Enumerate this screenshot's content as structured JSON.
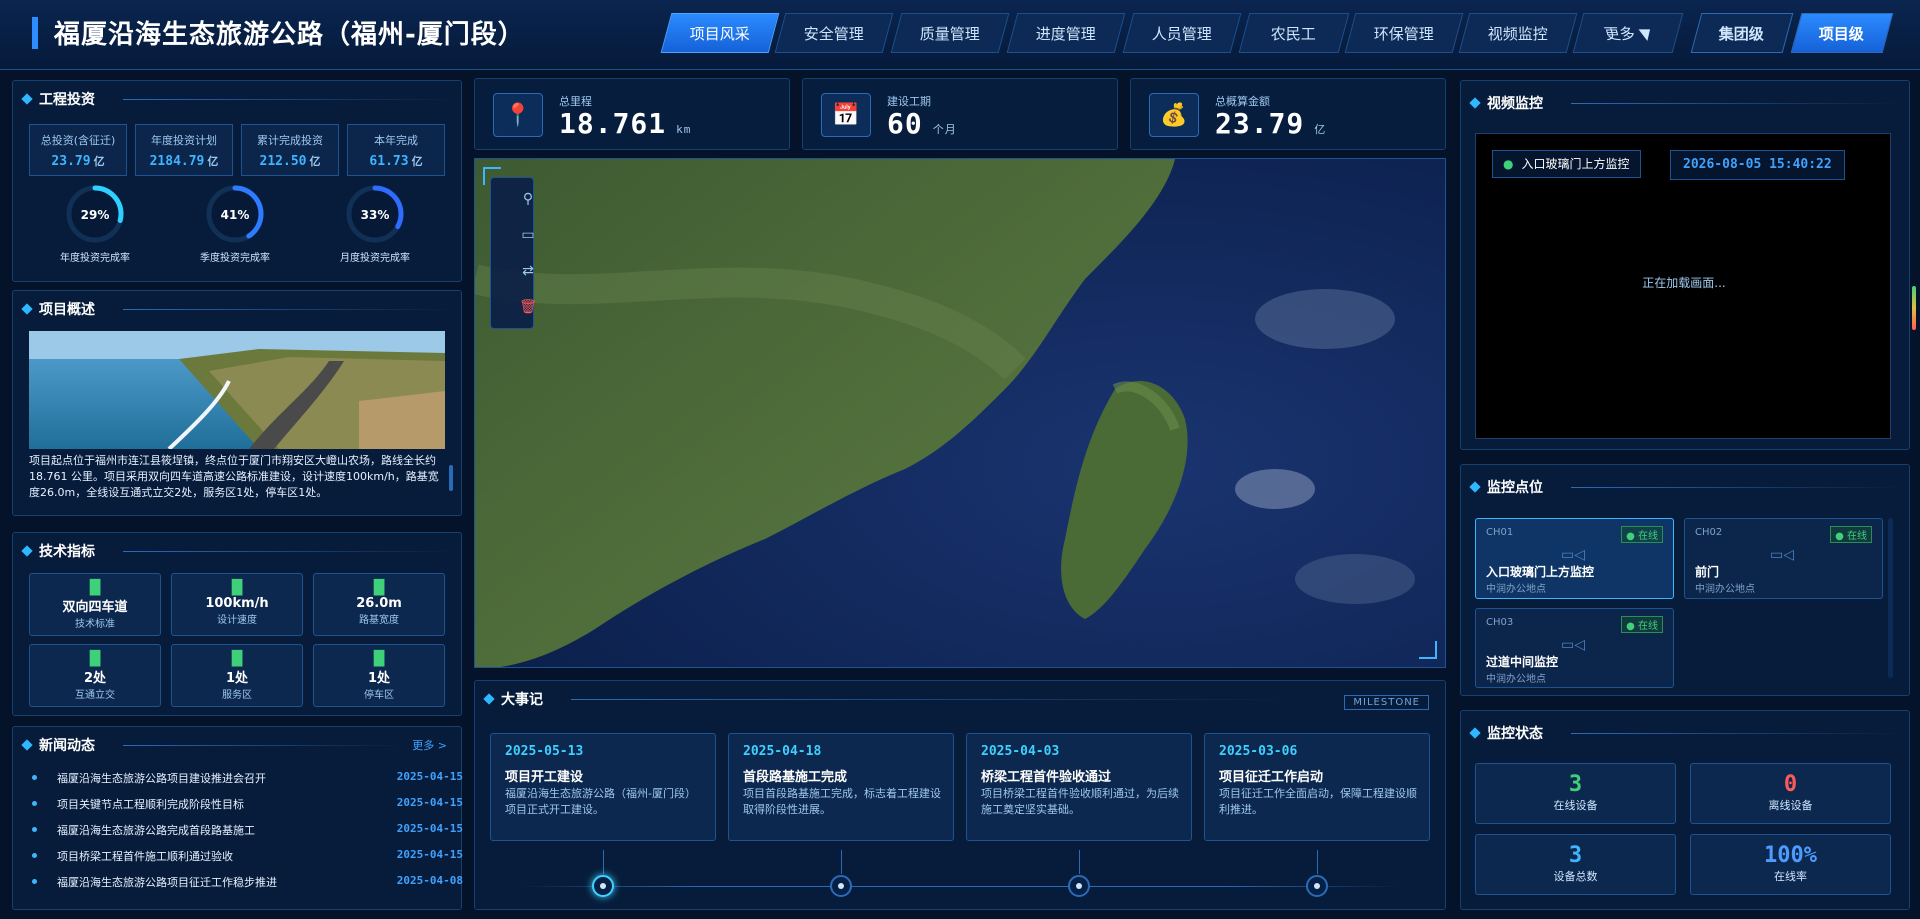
{
  "header": {
    "title": "福厦沿海生态旅游公路（福州-厦门段）",
    "tabs": [
      "项目风采",
      "安全管理",
      "质量管理",
      "进度管理",
      "人员管理",
      "农民工",
      "环保管理",
      "视频监控"
    ],
    "more_label": "更多",
    "level_tabs": [
      "集团级",
      "项目级"
    ],
    "active_tab": 0,
    "active_level": 1
  },
  "investment": {
    "title": "工程投资",
    "boxes": [
      {
        "label": "总投资(含征迁)",
        "value": "23.79",
        "unit": "亿"
      },
      {
        "label": "年度投资计划",
        "value": "2184.79",
        "unit": "亿"
      },
      {
        "label": "累计完成投资",
        "value": "212.50",
        "unit": "亿"
      },
      {
        "label": "本年完成",
        "value": "61.73",
        "unit": "亿"
      }
    ],
    "rings": [
      {
        "pct": 29,
        "text": "29%",
        "label": "年度投资完成率",
        "color": "#2ed0ff"
      },
      {
        "pct": 41,
        "text": "41%",
        "label": "季度投资完成率",
        "color": "#2e7bff"
      },
      {
        "pct": 33,
        "text": "33%",
        "label": "月度投资完成率",
        "color": "#2e6bff"
      }
    ]
  },
  "overview": {
    "title": "项目概述",
    "text": "项目起点位于福州市连江县筱埕镇，终点位于厦门市翔安区大嶝山农场，路线全长约 18.761 公里。项目采用双向四车道高速公路标准建设，设计速度100km/h，路基宽度26.0m，全线设互通式立交2处，服务区1处，停车区1处。"
  },
  "tech": {
    "title": "技术指标",
    "items": [
      {
        "value": "双向四车道",
        "label": "技术标准"
      },
      {
        "value": "100km/h",
        "label": "设计速度"
      },
      {
        "value": "26.0m",
        "label": "路基宽度"
      },
      {
        "value": "2处",
        "label": "互通立交"
      },
      {
        "value": "1处",
        "label": "服务区"
      },
      {
        "value": "1处",
        "label": "停车区"
      }
    ]
  },
  "news": {
    "title": "新闻动态",
    "more": "更多 >",
    "items": [
      {
        "title": "福厦沿海生态旅游公路项目建设推进会召开",
        "date": "2025-04-15"
      },
      {
        "title": "项目关键节点工程顺利完成阶段性目标",
        "date": "2025-04-15"
      },
      {
        "title": "福厦沿海生态旅游公路完成首段路基施工",
        "date": "2025-04-15"
      },
      {
        "title": "项目桥梁工程首件施工顺利通过验收",
        "date": "2025-04-15"
      },
      {
        "title": "福厦沿海生态旅游公路项目征迁工作稳步推进",
        "date": "2025-04-08"
      }
    ]
  },
  "stats": [
    {
      "label": "总里程",
      "value": "18.761",
      "unit": "km",
      "icon": "📍"
    },
    {
      "label": "建设工期",
      "value": "60",
      "unit": "个月",
      "icon": "📅"
    },
    {
      "label": "总概算金额",
      "value": "23.79",
      "unit": "亿",
      "icon": "💰"
    }
  ],
  "milestones": {
    "title": "大事记",
    "badge": "MILESTONE",
    "items": [
      {
        "date": "2025-05-13",
        "title": "项目开工建设",
        "desc": "福厦沿海生态旅游公路（福州-厦门段）项目正式开工建设。"
      },
      {
        "date": "2025-04-18",
        "title": "首段路基施工完成",
        "desc": "项目首段路基施工完成，标志着工程建设取得阶段性进展。"
      },
      {
        "date": "2025-04-03",
        "title": "桥梁工程首件验收通过",
        "desc": "项目桥梁工程首件验收顺利通过，为后续施工奠定坚实基础。"
      },
      {
        "date": "2025-03-06",
        "title": "项目征迁工作启动",
        "desc": "项目征迁工作全面启动，保障工程建设顺利推进。"
      }
    ]
  },
  "video": {
    "title": "视频监控",
    "camera_name": "入口玻璃门上方监控",
    "timestamp": "2026-08-05 15:40:22",
    "loading": "正在加载画面..."
  },
  "points": {
    "title": "监控点位",
    "items": [
      {
        "ch": "CH01",
        "status": "在线",
        "name": "入口玻璃门上方监控",
        "loc": "中润办公地点"
      },
      {
        "ch": "CH02",
        "status": "在线",
        "name": "前门",
        "loc": "中润办公地点"
      },
      {
        "ch": "CH03",
        "status": "在线",
        "name": "过道中间监控",
        "loc": "中润办公地点"
      }
    ]
  },
  "status": {
    "title": "监控状态",
    "items": [
      {
        "value": "3",
        "label": "在线设备",
        "color": "#3fd07a"
      },
      {
        "value": "0",
        "label": "离线设备",
        "color": "#ff5a5a"
      },
      {
        "value": "3",
        "label": "设备总数",
        "color": "#3fb5ff"
      },
      {
        "value": "100%",
        "label": "在线率",
        "color": "#4d9bff"
      }
    ]
  }
}
